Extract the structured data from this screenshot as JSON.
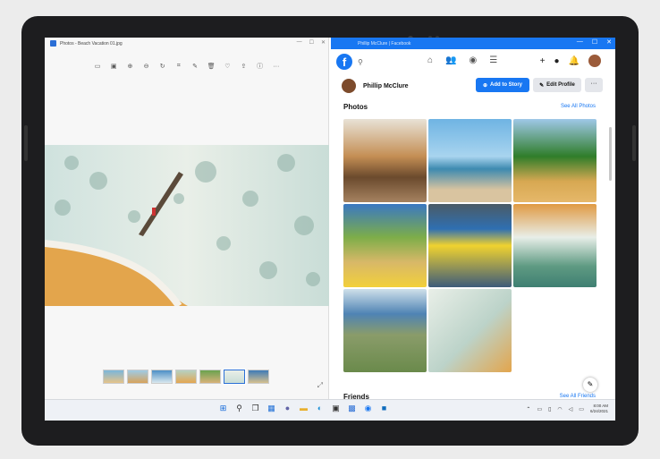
{
  "photos_window": {
    "title": "Photos - Beach Vacation 01.jpg",
    "window_controls": [
      "—",
      "☐",
      "✕"
    ],
    "toolbar_icons": [
      "image-icon",
      "slideshow-icon",
      "zoom-in-icon",
      "zoom-out-icon",
      "rotate-icon",
      "crop-icon",
      "edit-icon",
      "delete-icon",
      "favorite-icon",
      "share-icon",
      "info-icon",
      "more-icon"
    ]
  },
  "facebook_window": {
    "title": "Phillip McClure | Facebook",
    "window_controls": [
      "—",
      "☐",
      "✕"
    ],
    "logo_letter": "f",
    "profile_name": "Phillip McClure",
    "add_story_label": "Add to Story",
    "edit_profile_label": "Edit Profile",
    "more_label": "···",
    "photos_header": "Photos",
    "see_all_photos": "See All Photos",
    "friends_header": "Friends",
    "see_all_friends": "See All Friends"
  },
  "taskbar": {
    "icons": [
      "windows-icon",
      "search-icon",
      "task-view-icon",
      "widgets-icon",
      "chat-icon",
      "file-explorer-icon",
      "edge-icon",
      "store-icon",
      "photos-icon",
      "facebook-icon",
      "outlook-icon"
    ],
    "time": "8:00 AM",
    "date": "6/24/2021"
  }
}
